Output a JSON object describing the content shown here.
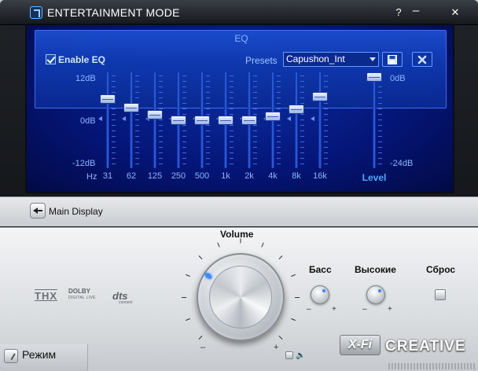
{
  "window": {
    "title": "ENTERTAINMENT MODE",
    "help_label": "?",
    "minimize_label": "–",
    "close_label": "✕"
  },
  "eq": {
    "section_title": "EQ",
    "enable_label": "Enable EQ",
    "enabled": true,
    "presets_label": "Presets",
    "preset_value": "Capushon_Int",
    "db_top": "12dB",
    "db_mid": "0dB",
    "db_bottom": "-12dB",
    "hz_label": "Hz",
    "bands": [
      {
        "freq": "31",
        "db": 6
      },
      {
        "freq": "62",
        "db": 3.5
      },
      {
        "freq": "125",
        "db": 1.5
      },
      {
        "freq": "250",
        "db": 0
      },
      {
        "freq": "500",
        "db": 0
      },
      {
        "freq": "1k",
        "db": 0
      },
      {
        "freq": "2k",
        "db": 0
      },
      {
        "freq": "4k",
        "db": 1
      },
      {
        "freq": "8k",
        "db": 3
      },
      {
        "freq": "16k",
        "db": 6.5
      }
    ],
    "level": {
      "label": "Level",
      "top_label": "0dB",
      "bottom_label": "-24dB",
      "db": 0
    }
  },
  "main_display": {
    "label": "Main Display"
  },
  "controls": {
    "volume_label": "Volume",
    "volume_minus": "–",
    "volume_plus": "+",
    "bass_label": "Басс",
    "treble_label": "Высокие",
    "reset_label": "Сброс",
    "knob_minus": "–",
    "knob_plus": "+"
  },
  "logos": {
    "thx": "THX",
    "dolby": "DOLBY",
    "dolby_sub": "DIGITAL LIVE",
    "dts": "dts",
    "dts_sub": "connect",
    "xfi": "X-Fi",
    "creative": "CREATIVE"
  },
  "mode": {
    "label": "Режим"
  },
  "icons": {
    "save": "floppy-disk-icon",
    "delete": "x-icon",
    "back": "arrow-left-icon",
    "speaker": "speaker-icon"
  }
}
